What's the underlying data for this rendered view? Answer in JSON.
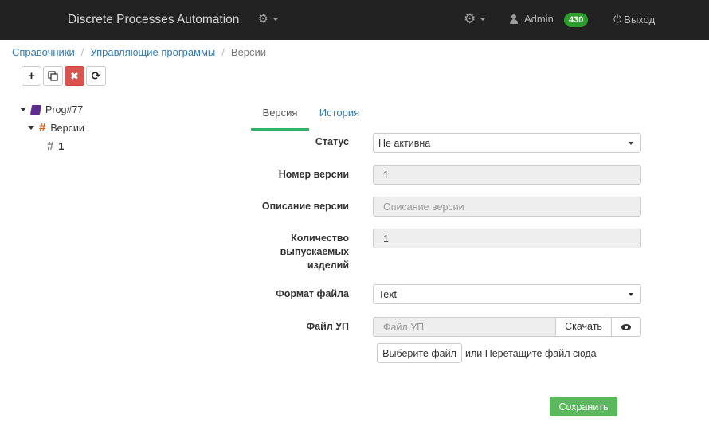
{
  "navbar": {
    "brand": "Discrete Processes Automation",
    "user": "Admin",
    "badge": "430",
    "logout": "Выход"
  },
  "breadcrumb": {
    "items": [
      "Справочники",
      "Управляющие программы"
    ],
    "active": "Версии"
  },
  "tree": {
    "root": "Prog#77",
    "child": "Версии",
    "leaf": "1"
  },
  "tabs": [
    "Версия",
    "История"
  ],
  "form": {
    "status_label": "Статус",
    "status_value": "Не активна",
    "version_number_label": "Номер версии",
    "version_number_value": "1",
    "version_desc_label": "Описание версии",
    "version_desc_placeholder": "Описание версии",
    "quantity_label_lines": [
      "Количество",
      "выпускаемых",
      "изделий"
    ],
    "quantity_value": "1",
    "file_format_label": "Формат файла",
    "file_format_value": "Text",
    "file_label": "Файл УП",
    "file_placeholder": "Файл УП",
    "download_label": "Скачать",
    "choose_file_label": "Выберите файл",
    "drop_text": "или Перетащите файл сюда",
    "save_label": "Сохранить"
  },
  "colors": {
    "navbar_bg": "#222222",
    "accent_green": "#2fb56a",
    "save_green": "#5cb85c",
    "danger_red": "#d9534f",
    "link_blue": "#337ab7",
    "badge_green": "#2c9c2c"
  },
  "icons": {
    "cogs": "cogs-icon",
    "gear": "gear-icon",
    "user": "user-icon",
    "power": "power-icon",
    "add": "plus-icon",
    "copy": "copy-icon",
    "delete": "remove-icon",
    "refresh": "refresh-icon",
    "book": "book-icon",
    "hash": "hash-icon",
    "eye": "eye-icon"
  }
}
